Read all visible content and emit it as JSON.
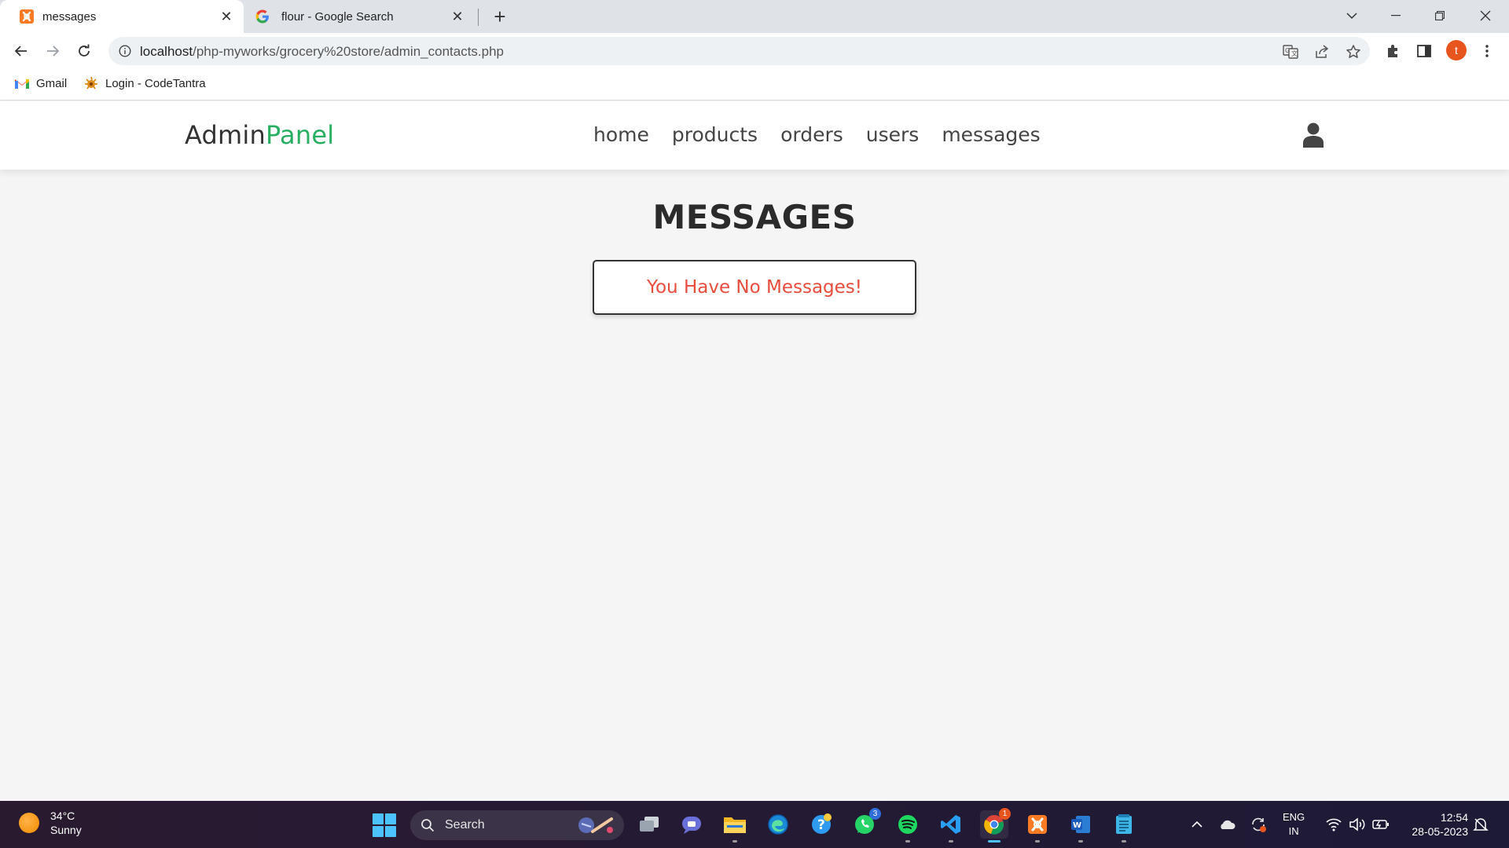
{
  "browser": {
    "tabs": [
      {
        "label": "messages",
        "active": true,
        "favicon": "xampp-icon"
      },
      {
        "label": "flour - Google Search",
        "active": false,
        "favicon": "google-icon"
      }
    ],
    "url_host": "localhost",
    "url_path": "/php-myworks/grocery%20store/admin_contacts.php",
    "profile_initial": "t",
    "bookmarks": [
      {
        "label": "Gmail",
        "icon": "gmail-icon"
      },
      {
        "label": "Login - CodeTantra",
        "icon": "codetantra-icon"
      }
    ]
  },
  "site": {
    "logo_main": "Admin",
    "logo_accent": "Panel",
    "logo_accent_color": "#27ae60",
    "nav": [
      "home",
      "products",
      "orders",
      "users",
      "messages"
    ],
    "page_title": "MESSAGES",
    "empty_message": "You Have No Messages!",
    "empty_message_color": "#e74c3c"
  },
  "taskbar": {
    "weather_temp": "34°C",
    "weather_desc": "Sunny",
    "search_label": "Search",
    "whatsapp_badge": "3",
    "chrome_badge": "1",
    "lang_line1": "ENG",
    "lang_line2": "IN",
    "time": "12:54",
    "date": "28-05-2023"
  }
}
